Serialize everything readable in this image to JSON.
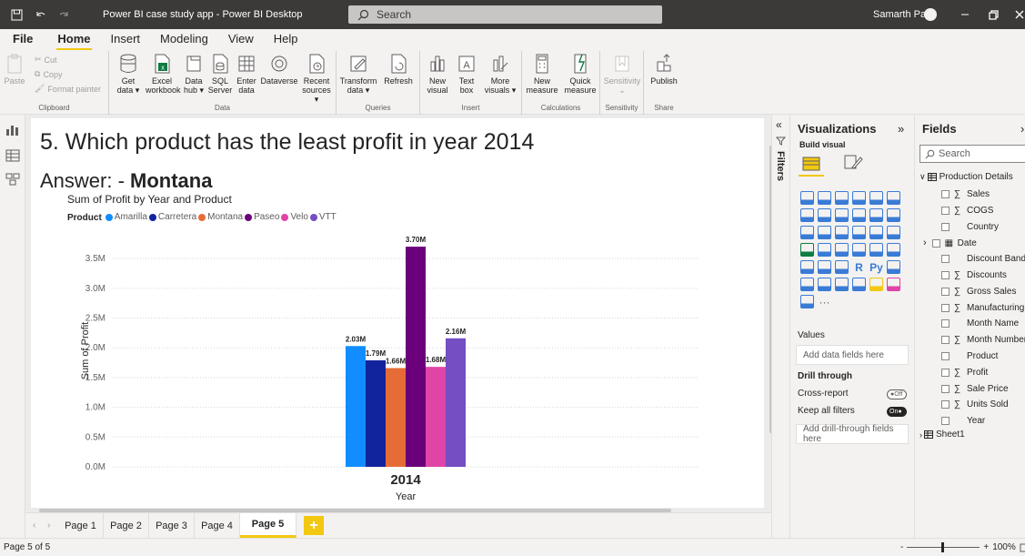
{
  "titlebar": {
    "title": "Power BI case study app - Power BI Desktop",
    "search": "Search",
    "user": "Samarth Patil"
  },
  "menu": [
    "File",
    "Home",
    "Insert",
    "Modeling",
    "View",
    "Help"
  ],
  "ribbon": {
    "clipboard": {
      "paste": "Paste",
      "cut": "Cut",
      "copy": "Copy",
      "format_painter": "Format painter",
      "label": "Clipboard"
    },
    "data": {
      "get_data": [
        "Get",
        "data"
      ],
      "excel": [
        "Excel",
        "workbook"
      ],
      "hub": [
        "Data",
        "hub"
      ],
      "sql": [
        "SQL",
        "Server"
      ],
      "enter": [
        "Enter",
        "data"
      ],
      "dataverse": "Dataverse",
      "recent": [
        "Recent",
        "sources"
      ],
      "label": "Data"
    },
    "queries": {
      "transform": [
        "Transform",
        "data"
      ],
      "refresh": "Refresh",
      "label": "Queries"
    },
    "insert": {
      "new_visual": [
        "New",
        "visual"
      ],
      "text_box": [
        "Text",
        "box"
      ],
      "more_visuals": [
        "More",
        "visuals"
      ],
      "label": "Insert"
    },
    "calculations": {
      "new_measure": [
        "New",
        "measure"
      ],
      "quick_measure": [
        "Quick",
        "measure"
      ],
      "label": "Calculations"
    },
    "sensitivity": {
      "btn": "Sensitivity",
      "label": "Sensitivity"
    },
    "share": {
      "publish": "Publish",
      "label": "Share"
    }
  },
  "report": {
    "question": "5. Which product has the least profit in year 2014",
    "answer_prefix": "Answer: - ",
    "answer_value": "Montana"
  },
  "chart_data": {
    "type": "bar",
    "title": "Sum of Profit by Year and Product",
    "legend_title": "Product",
    "xlabel": "Year",
    "ylabel": "Sum of Profit",
    "categories": [
      "2014"
    ],
    "series": [
      {
        "name": "Amarilla",
        "values": [
          2.03
        ],
        "label": "2.03M",
        "color": "#118dff"
      },
      {
        "name": "Carretera",
        "values": [
          1.79
        ],
        "label": "1.79M",
        "color": "#12239e"
      },
      {
        "name": "Montana",
        "values": [
          1.66
        ],
        "label": "1.66M",
        "color": "#e66c37"
      },
      {
        "name": "Paseo",
        "values": [
          3.7
        ],
        "label": "3.70M",
        "color": "#6b007b"
      },
      {
        "name": "Velo",
        "values": [
          1.68
        ],
        "label": "1.68M",
        "color": "#e044a7"
      },
      {
        "name": "VTT",
        "values": [
          2.16
        ],
        "label": "2.16M",
        "color": "#744ec2"
      }
    ],
    "yticks": [
      "0.0M",
      "0.5M",
      "1.0M",
      "1.5M",
      "2.0M",
      "2.5M",
      "3.0M",
      "3.5M"
    ],
    "ylim": [
      0,
      3.9
    ],
    "units": "M",
    "legend_position": "top-left",
    "grid": true
  },
  "page_tabs": [
    "Page 1",
    "Page 2",
    "Page 3",
    "Page 4",
    "Page 5"
  ],
  "active_page": "Page 5",
  "add_page": "+",
  "status": {
    "page": "Page 5 of 5",
    "zoom": "100%",
    "zoom_minus": "-",
    "zoom_plus": "+"
  },
  "filters": {
    "label": "Filters"
  },
  "visualizations": {
    "title": "Visualizations",
    "build_visual": "Build visual",
    "values": "Values",
    "values_placeholder": "Add data fields here",
    "drill_through": "Drill through",
    "cross_report": "Cross-report",
    "cross_report_state": "Off",
    "keep_all_filters": "Keep all filters",
    "keep_all_filters_state": "On",
    "drill_placeholder": "Add drill-through fields here",
    "more": "···",
    "r_icon": "R",
    "py_icon": "Py"
  },
  "fields": {
    "title": "Fields",
    "search": "Search",
    "table": "Production Details",
    "items": [
      {
        "label": "Sales",
        "sigma": true
      },
      {
        "label": "COGS",
        "sigma": true
      },
      {
        "label": "Country",
        "sigma": false
      },
      {
        "label": "Date",
        "sigma": false,
        "expandable": true
      },
      {
        "label": "Discount Band",
        "sigma": false
      },
      {
        "label": "Discounts",
        "sigma": true
      },
      {
        "label": "Gross Sales",
        "sigma": true
      },
      {
        "label": "Manufacturing P",
        "sigma": true
      },
      {
        "label": "Month Name",
        "sigma": false
      },
      {
        "label": "Month Number",
        "sigma": true
      },
      {
        "label": "Product",
        "sigma": false
      },
      {
        "label": "Profit",
        "sigma": true
      },
      {
        "label": "Sale Price",
        "sigma": true
      },
      {
        "label": "Units Sold",
        "sigma": true
      },
      {
        "label": "Year",
        "sigma": false
      }
    ],
    "sheet": "Sheet1"
  }
}
